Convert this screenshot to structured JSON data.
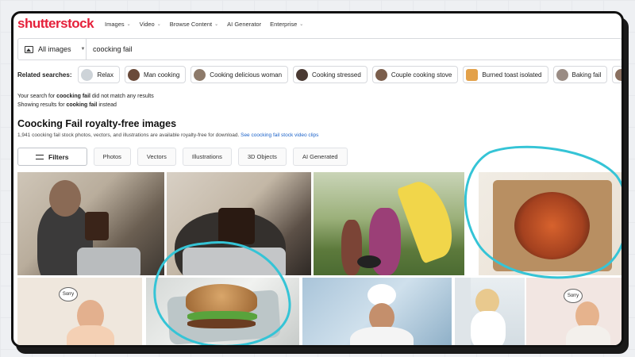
{
  "header": {
    "logo": "shutterstock",
    "nav": [
      "Images",
      "Video",
      "Browse Content",
      "AI Generator",
      "Enterprise"
    ]
  },
  "search": {
    "type_label": "All images",
    "query": "coocking fail"
  },
  "related": {
    "label": "Related searches:",
    "items": [
      "Relax",
      "Man cooking",
      "Cooking delicious woman",
      "Cooking stressed",
      "Couple cooking stove",
      "Burned toast isolated",
      "Baking fail",
      "Co"
    ]
  },
  "messages": {
    "line1_pre": "Your search for ",
    "line1_term": "coocking fail",
    "line1_post": " did not match any results",
    "line2_pre": "Showing results for ",
    "line2_term": "cooking fail",
    "line2_post": " instead"
  },
  "results": {
    "title": "Coocking Fail royalty-free images",
    "subtitle": "1,941 coocking fail stock photos, vectors, and illustrations are available royalty-free for download.",
    "video_link": "See coocking fail stock video clips"
  },
  "filters": {
    "button": "Filters",
    "types": [
      "Photos",
      "Vectors",
      "Illustrations",
      "3D Objects",
      "AI Generated"
    ]
  },
  "illustrations": {
    "bubble_left": "Sorry",
    "bubble_right": "Sorry"
  },
  "colors": {
    "brand": "#e5203a",
    "annotation": "#35c4d6",
    "link": "#1c63c9"
  }
}
